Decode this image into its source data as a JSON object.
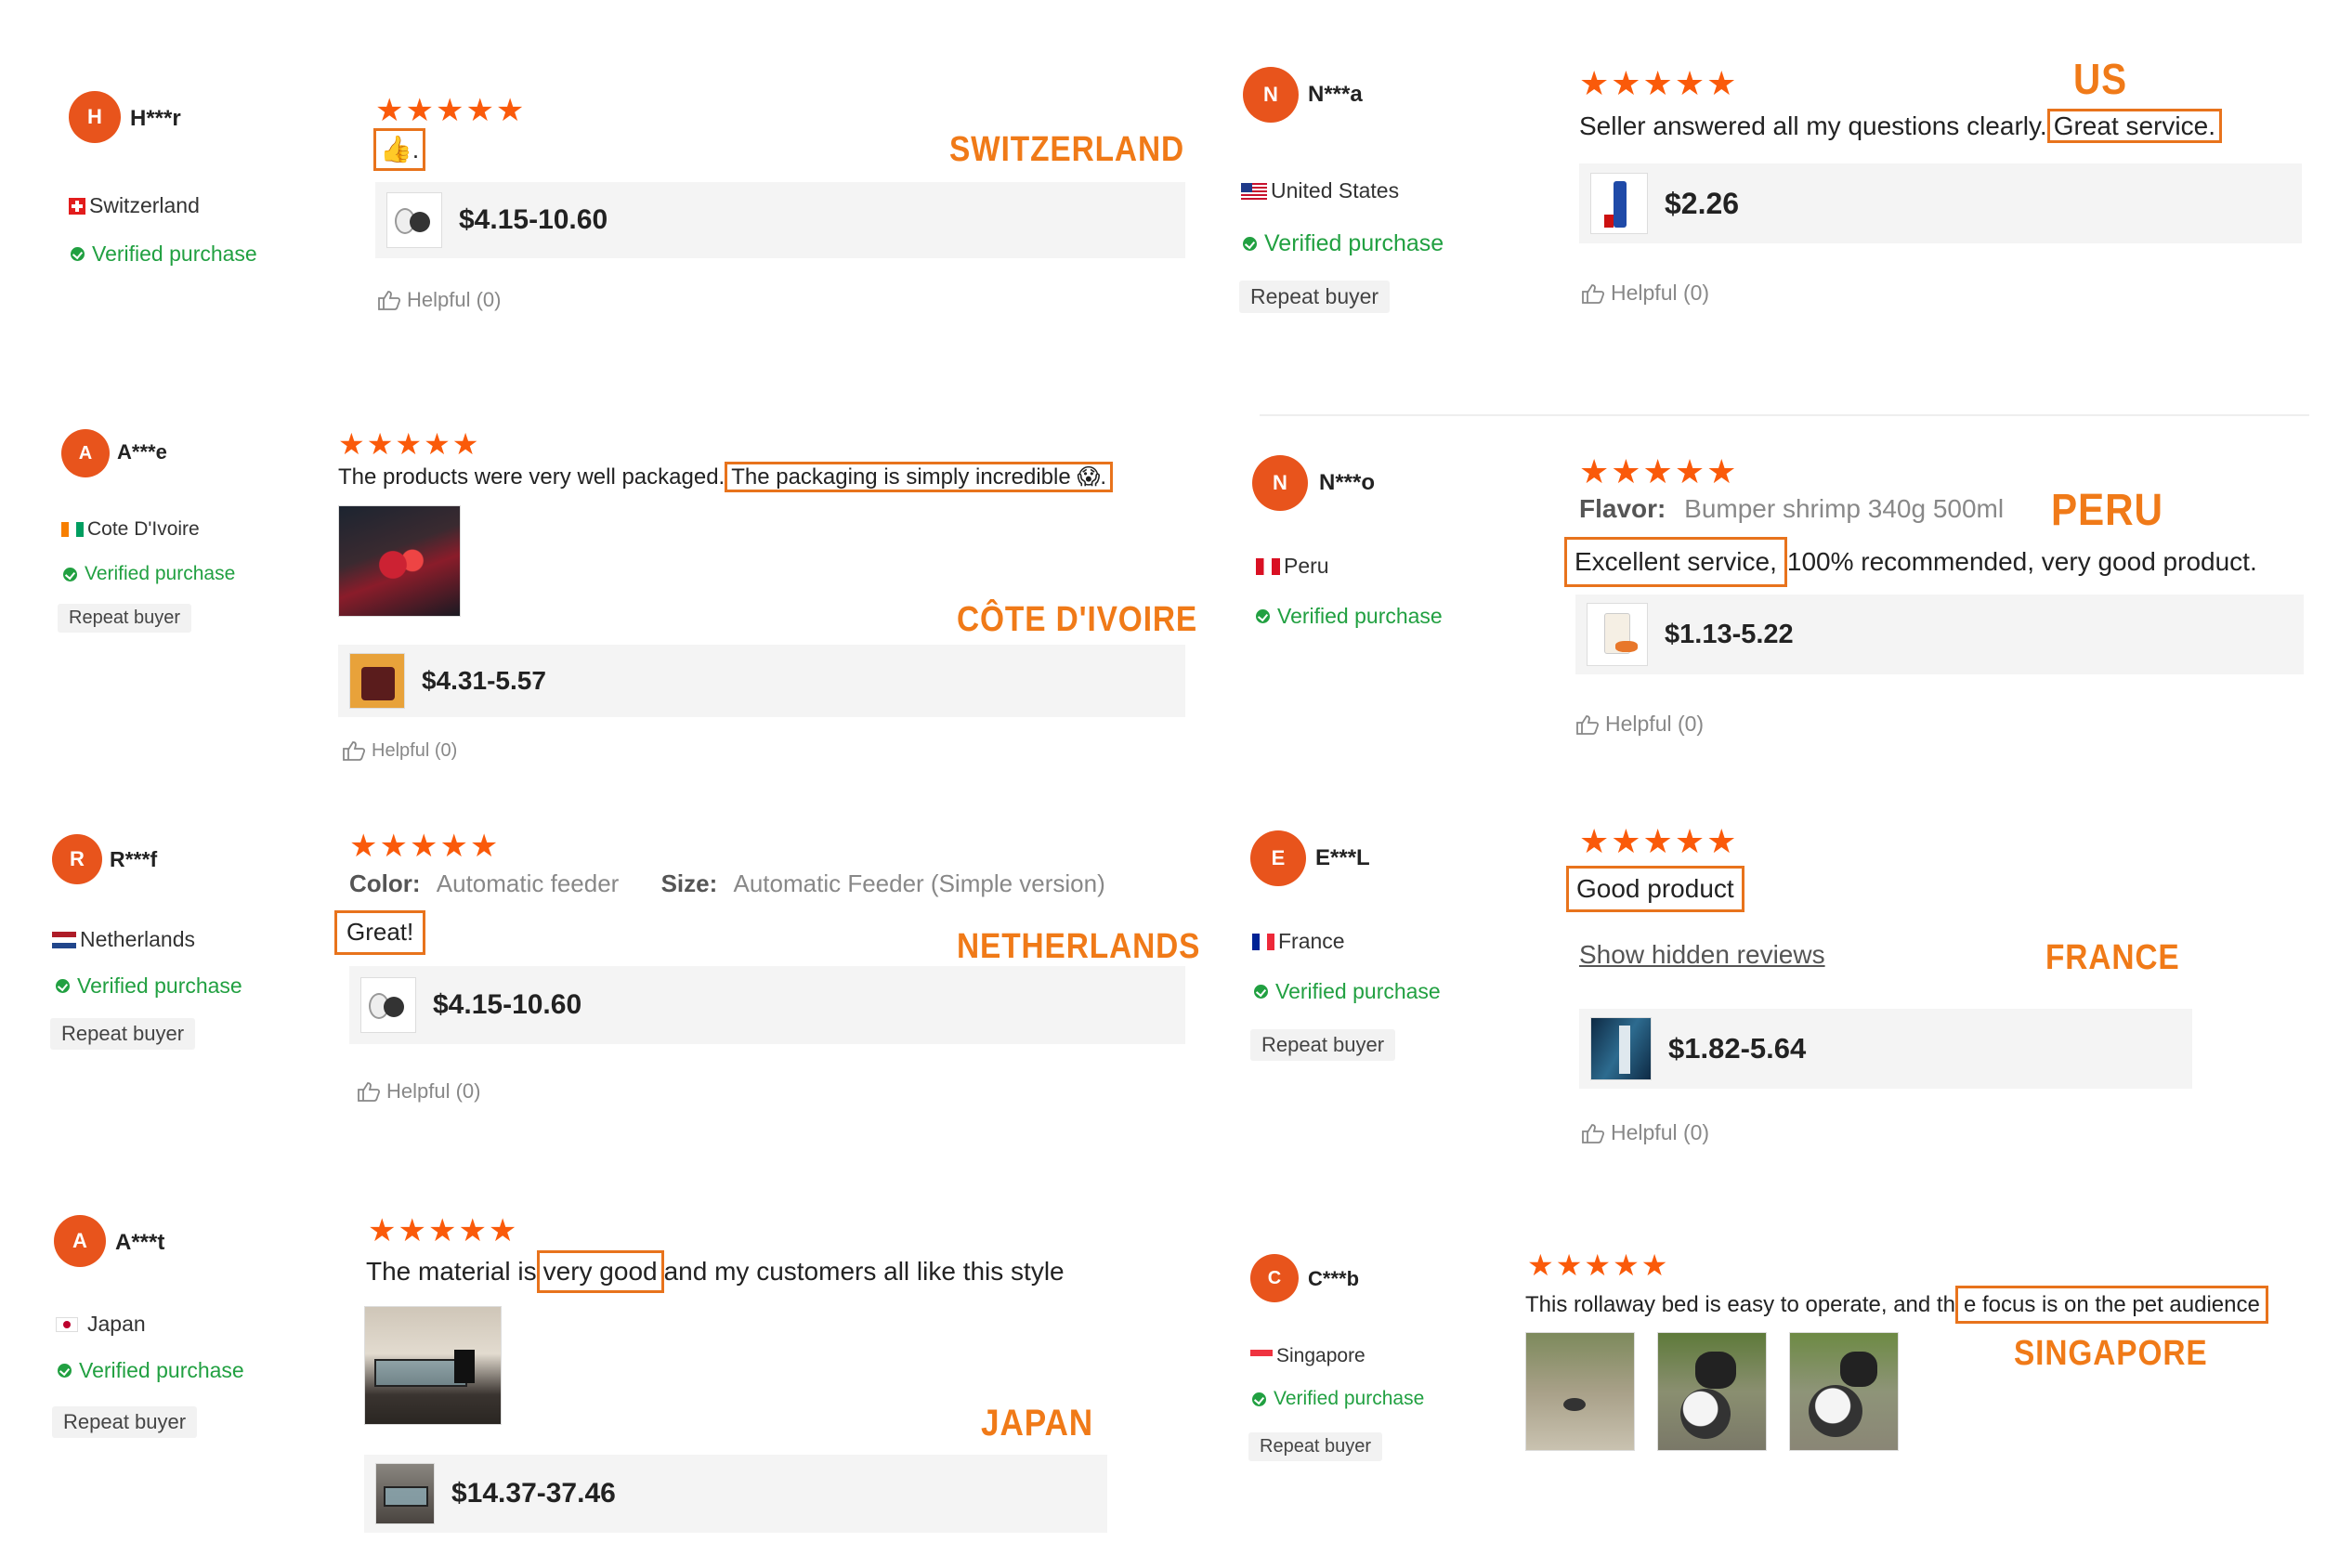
{
  "reviews": [
    {
      "id": "switzerland",
      "avatar_letter": "H",
      "user": "H***r",
      "country": "Switzerland",
      "verified": "Verified purchase",
      "stars": "★★★★★",
      "emoji": "👍",
      "text_after": ".",
      "price": "$4.15-10.60",
      "helpful": "Helpful (0)",
      "label": "SWITZERLAND"
    },
    {
      "id": "us",
      "avatar_letter": "N",
      "user": "N***a",
      "country": "United States",
      "verified": "Verified purchase",
      "repeat": "Repeat buyer",
      "stars": "★★★★★",
      "text_pre": "Seller answered all my questions clearly.",
      "text_hl": "Great service.",
      "price": "$2.26",
      "helpful": "Helpful (0)",
      "label": "US"
    },
    {
      "id": "cote",
      "avatar_letter": "A",
      "user": "A***e",
      "country": "Cote D'Ivoire",
      "verified": "Verified purchase",
      "repeat": "Repeat buyer",
      "stars": "★★★★★",
      "text_pre": "The products were very well packaged.",
      "text_hl": "The packaging is simply incredible 😱.",
      "price": "$4.31-5.57",
      "helpful": "Helpful (0)",
      "label": "CÔTE D'IVOIRE"
    },
    {
      "id": "peru",
      "avatar_letter": "N",
      "user": "N***o",
      "country": "Peru",
      "verified": "Verified purchase",
      "stars": "★★★★★",
      "flavor_key": "Flavor:",
      "flavor_val": "Bumper shrimp 340g 500ml",
      "text_hl": "Excellent service,",
      "text_post": "100% recommended, very good product.",
      "price": "$1.13-5.22",
      "helpful": "Helpful (0)",
      "label": "PERU"
    },
    {
      "id": "netherlands",
      "avatar_letter": "R",
      "user": "R***f",
      "country": "Netherlands",
      "verified": "Verified purchase",
      "repeat": "Repeat buyer",
      "stars": "★★★★★",
      "color_key": "Color:",
      "color_val": "Automatic feeder",
      "size_key": "Size:",
      "size_val": "Automatic Feeder (Simple version)",
      "text_hl": "Great!",
      "price": "$4.15-10.60",
      "helpful": "Helpful (0)",
      "label": "NETHERLANDS"
    },
    {
      "id": "france",
      "avatar_letter": "E",
      "user": "E***L",
      "country": "France",
      "verified": "Verified purchase",
      "repeat": "Repeat buyer",
      "stars": "★★★★★",
      "text_hl": "Good product",
      "show_hidden": "Show hidden reviews",
      "price": "$1.82-5.64",
      "helpful": "Helpful (0)",
      "label": "FRANCE"
    },
    {
      "id": "japan",
      "avatar_letter": "A",
      "user": "A***t",
      "country": "Japan",
      "verified": "Verified purchase",
      "repeat": "Repeat buyer",
      "stars": "★★★★★",
      "text_pre": "The material is",
      "text_hl": "very good",
      "text_post": "and my customers all like this style",
      "price": "$14.37-37.46",
      "label": "JAPAN"
    },
    {
      "id": "singapore",
      "avatar_letter": "C",
      "user": "C***b",
      "country": "Singapore",
      "verified": "Verified purchase",
      "repeat": "Repeat buyer",
      "stars": "★★★★★",
      "text_pre": "This rollaway bed is easy to operate, and th",
      "text_hl": "e focus is on the pet audience",
      "label": "SINGAPORE"
    }
  ],
  "colors": {
    "accent": "#e8541c",
    "star": "#fa5a0a",
    "label": "#f07a18",
    "verified": "#21a041",
    "highlight_box": "#e8731c"
  }
}
